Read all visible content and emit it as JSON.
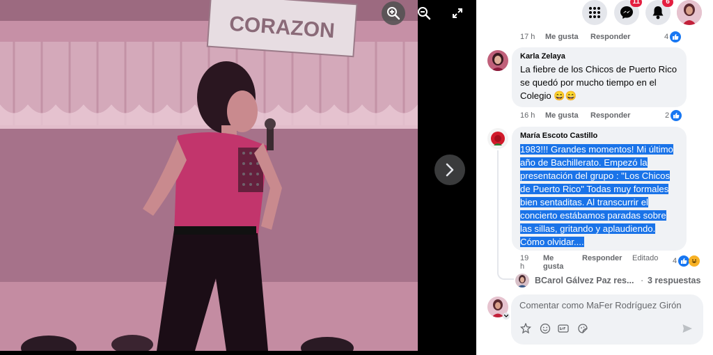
{
  "viewer": {
    "photo_sign_text": "CORAZON",
    "zoom_in_icon": "zoom-in-icon",
    "zoom_out_icon": "zoom-out-icon",
    "fullscreen_icon": "expand-icon",
    "next_icon": "chevron-right-icon"
  },
  "topbar": {
    "menu_icon": "grid-menu-icon",
    "messenger_icon": "messenger-icon",
    "messenger_badge": "11",
    "notifications_icon": "bell-icon",
    "notifications_badge": "6"
  },
  "comments": [
    {
      "time": "17 h",
      "like_label": "Me gusta",
      "reply_label": "Responder",
      "reactions": "4"
    },
    {
      "author": "Karla Zelaya",
      "text": "La fiebre de los Chicos de Puerto Rico se quedó por mucho tiempo en el Colegio 😄😄",
      "time": "16 h",
      "like_label": "Me gusta",
      "reply_label": "Responder",
      "reactions": "2"
    },
    {
      "author": "María Escoto Castillo",
      "text": "1983!!! Grandes momentos! Mi último año de Bachillerato. Empezó la presentación del grupo : \"Los Chicos de Puerto Rico\" Todas muy formales bien sentaditas. Al transcurrir el concierto estábamos paradas sobre las sillas, gritando y aplaudiendo. Cómo olvidar....",
      "time_line1": "19",
      "time_line2": "h",
      "like_line1": "Me",
      "like_line2": "gusta",
      "reply_label": "Responder",
      "edited_label": "Editado",
      "reactions": "4"
    }
  ],
  "replies_summary": {
    "author_preview": "BCarol Gálvez Paz res...",
    "separator": "·",
    "count_label": "3 respuestas"
  },
  "composer": {
    "placeholder": "Comentar como MaFer Rodríguez Girón",
    "icons": [
      "sticker-avatar-icon",
      "emoji-icon",
      "gif-icon",
      "sticker-icon",
      "send-icon"
    ]
  },
  "colors": {
    "accent": "#1877f2",
    "selection": "#1a73e8",
    "badge": "#e41e3f",
    "photo_tint": "#c48ca2"
  }
}
